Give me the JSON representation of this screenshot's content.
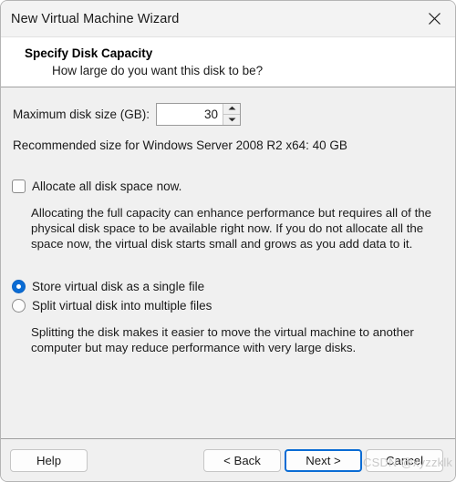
{
  "window": {
    "title": "New Virtual Machine Wizard",
    "close_icon": "close-icon"
  },
  "header": {
    "title": "Specify Disk Capacity",
    "subtitle": "How large do you want this disk to be?"
  },
  "disk_size": {
    "label": "Maximum disk size (GB):",
    "value": "30",
    "placeholder": "",
    "spinner_up_icon": "chevron-up-icon",
    "spinner_down_icon": "chevron-down-icon"
  },
  "recommendation": "Recommended size for Windows Server 2008 R2 x64: 40 GB",
  "allocate": {
    "label": "Allocate all disk space now.",
    "checked": false,
    "description": "Allocating the full capacity can enhance performance but requires all of the physical disk space to be available right now. If you do not allocate all the space now, the virtual disk starts small and grows as you add data to it."
  },
  "storage_options": {
    "single_file_label": "Store virtual disk as a single file",
    "split_files_label": "Split virtual disk into multiple files",
    "selected": "single_file",
    "description": "Splitting the disk makes it easier to move the virtual machine to another computer but may reduce performance with very large disks."
  },
  "footer": {
    "help_label": "Help",
    "back_label": "< Back",
    "next_label": "Next >",
    "cancel_label": "Cancel"
  },
  "watermark": "CSDN @xyzzklk",
  "colors": {
    "accent": "#0a6cd4",
    "window_background": "#f0f0f0",
    "header_background": "#ffffff",
    "titlebar_background": "#f3f3f3"
  }
}
